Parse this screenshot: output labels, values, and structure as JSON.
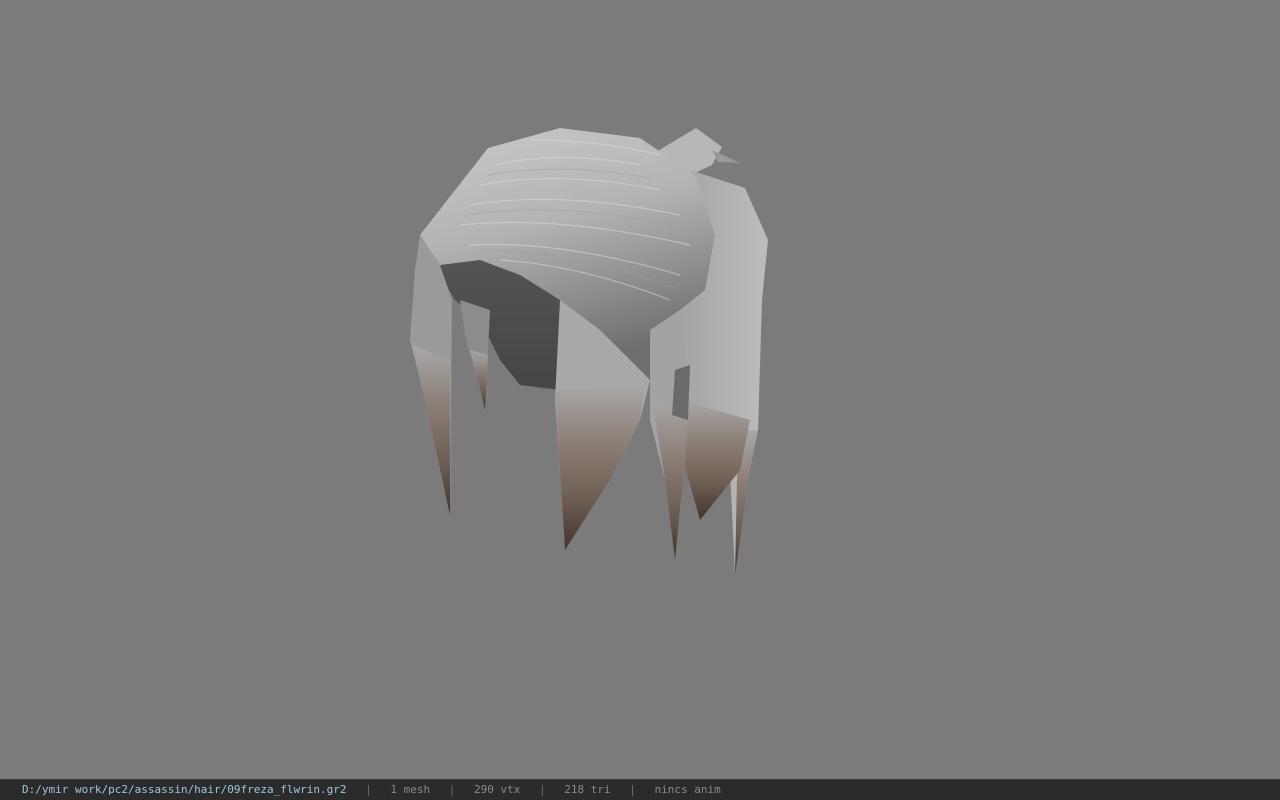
{
  "viewport": {
    "background": "#7b7b7b",
    "model_name": "hair-mesh-icon"
  },
  "statusbar": {
    "path": "D:/ymir work/pc2/assassin/hair/09freza_flwrin.gr2",
    "separator": "|",
    "mesh_count": "1 mesh",
    "vertex_count": "290 vtx",
    "triangle_count": "218 tri",
    "anim_status": "nincs anim"
  },
  "colors": {
    "path_text": "#9ec8d8",
    "stat_text": "#8a8a8a",
    "bar_bg": "#2b2b2b"
  }
}
